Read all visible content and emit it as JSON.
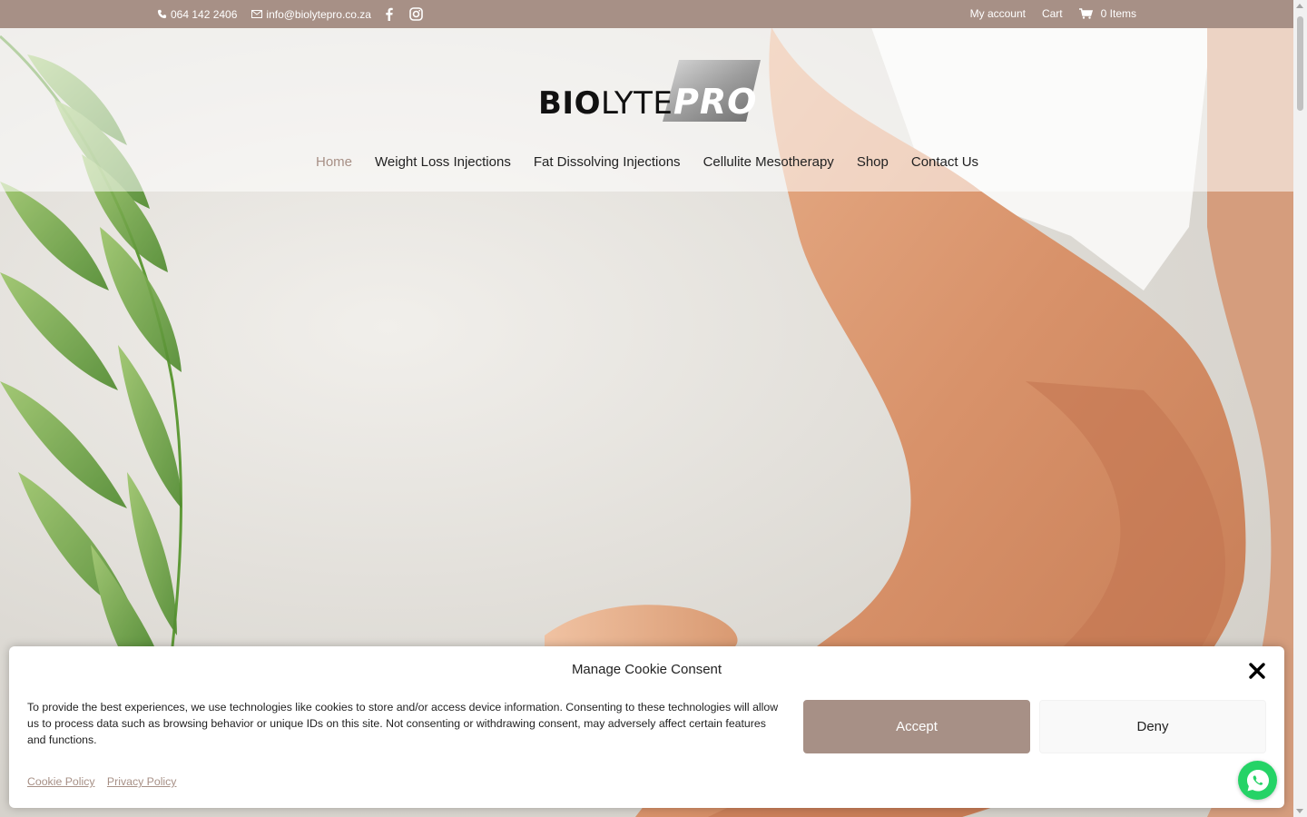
{
  "topbar": {
    "phone": "064 142 2406",
    "email": "info@biolytepro.co.za",
    "social": [
      "facebook-icon",
      "instagram-icon"
    ],
    "my_account": "My account",
    "cart": "Cart",
    "cart_items": "0 Items"
  },
  "logo": {
    "bio_bold": "BIO",
    "bio_light": "LYTE",
    "pro": "PRO"
  },
  "nav": {
    "items": [
      {
        "label": "Home",
        "active": true
      },
      {
        "label": "Weight Loss Injections",
        "active": false
      },
      {
        "label": "Fat Dissolving Injections",
        "active": false
      },
      {
        "label": "Cellulite Mesotherapy",
        "active": false
      },
      {
        "label": "Shop",
        "active": false
      },
      {
        "label": "Contact Us",
        "active": false
      }
    ]
  },
  "cookie": {
    "title": "Manage Cookie Consent",
    "message": "To provide the best experiences, we use technologies like cookies to store and/or access device information. Consenting to these technologies will allow us to process data such as browsing behavior or unique IDs on this site. Not consenting or withdrawing consent, may adversely affect certain features and functions.",
    "accept_label": "Accept",
    "deny_label": "Deny",
    "cookie_policy": "Cookie Policy",
    "privacy_policy": "Privacy Policy"
  },
  "colors": {
    "brand": "#a79086",
    "whatsapp": "#25d366"
  }
}
